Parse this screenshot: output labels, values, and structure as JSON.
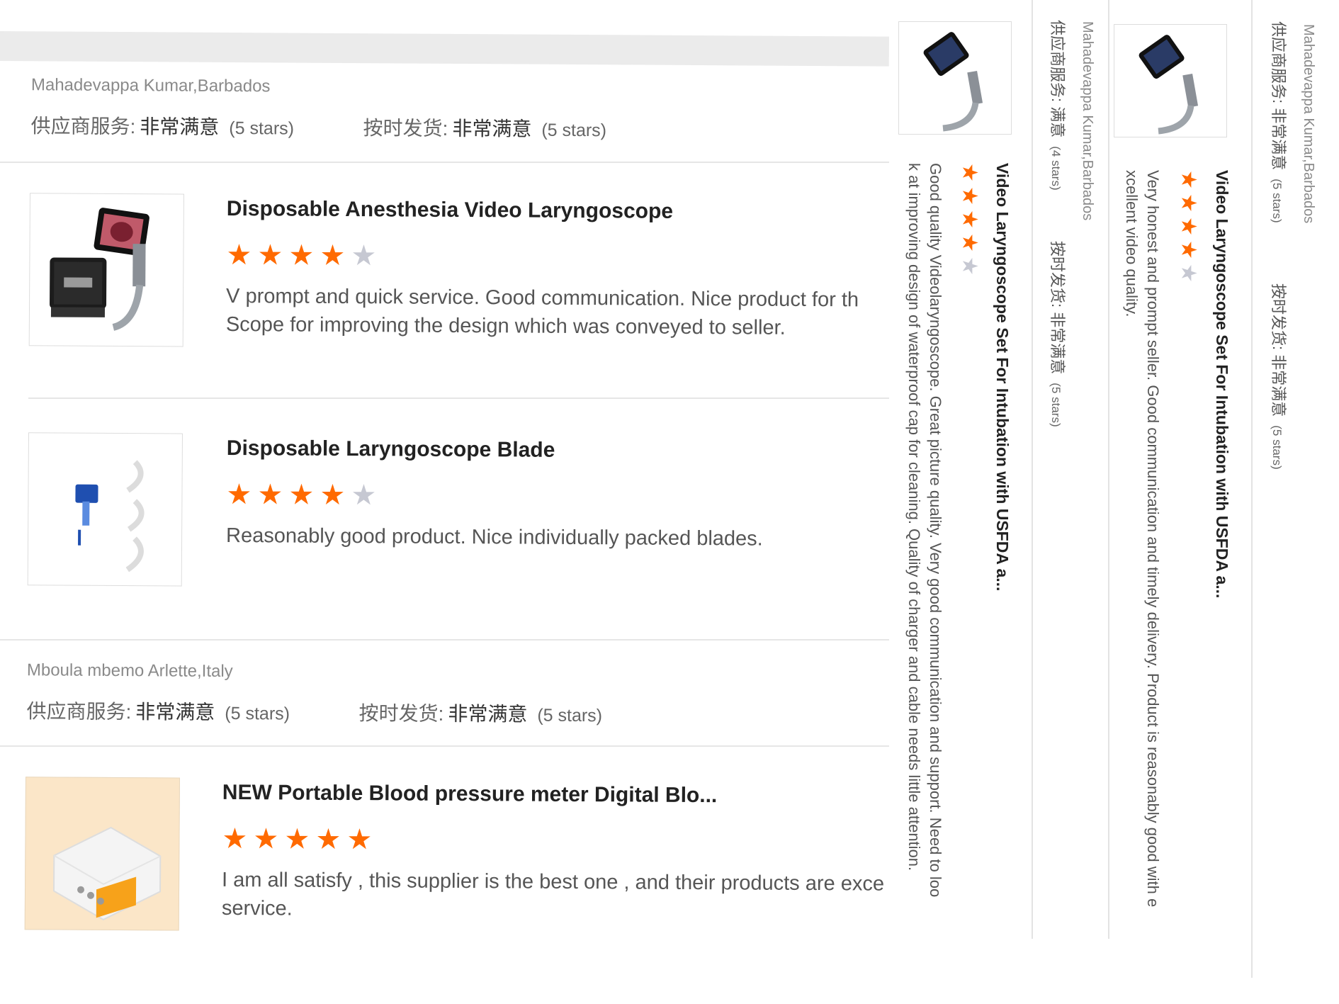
{
  "reviews": [
    {
      "reviewer": "Mahadevappa Kumar,Barbados",
      "supplier_label": "供应商服务:",
      "supplier_value": "非常满意",
      "supplier_stars": "(5 stars)",
      "delivery_label": "按时发货:",
      "delivery_value": "非常满意",
      "delivery_stars": "(5 stars)",
      "products": [
        {
          "title": "Disposable Anesthesia Video Laryngoscope",
          "rating": 4,
          "text_line1": "V prompt and quick service. Good communication. Nice product for th",
          "text_line2": "Scope for improving the design which was conveyed to seller.",
          "thumb_icon": "laryngoscope-case-icon"
        },
        {
          "title": "Disposable Laryngoscope Blade",
          "rating": 4,
          "text_line1": "Reasonably good product. Nice individually packed blades.",
          "thumb_icon": "laryngoscope-blade-icon"
        }
      ]
    },
    {
      "reviewer": "Mboula mbemo Arlette,Italy",
      "supplier_label": "供应商服务:",
      "supplier_value": "非常满意",
      "supplier_stars": "(5 stars)",
      "delivery_label": "按时发货:",
      "delivery_value": "非常满意",
      "delivery_stars": "(5 stars)",
      "products": [
        {
          "title": "NEW Portable Blood pressure meter Digital Blo...",
          "rating": 5,
          "text_line1": "I am all satisfy , this supplier is the best one , and their products are exce",
          "text_line2": "service.",
          "thumb_icon": "blood-pressure-monitor-icon"
        }
      ]
    }
  ],
  "rotated": {
    "col1": {
      "title": "Video Laryngoscope Set For Intubation with USFDA a...",
      "rating": 4,
      "text_line1": "Good quality Videolaryngoscope. Great picture quality. Very good communication and support. Need to loo",
      "text_line2": "k at improving design of waterproof cap for cleaning. Quality of charger and cable needs little attention."
    },
    "col2": {
      "reviewer": "Mahadevappa Kumar,Barbados",
      "supplier_label": "供应商服务:",
      "supplier_value": "满意",
      "supplier_stars": "(4 stars)",
      "delivery_label": "按时发货:",
      "delivery_value": "非常满意",
      "delivery_stars": "(5 stars)"
    },
    "col3": {
      "title": "Video Laryngoscope Set For Intubation with USFDA a...",
      "rating": 4,
      "text_line1": "Very honest and prompt seller. Good communication and timely delivery. Product is reasonably good with e",
      "text_line2": "xcellent video quality."
    },
    "col4": {
      "reviewer": "Mahadevappa Kumar,Barbados",
      "supplier_label": "供应商服务:",
      "supplier_value": "非常满意",
      "supplier_stars": "(5 stars)",
      "delivery_label": "按时发货:",
      "delivery_value": "非常满意",
      "delivery_stars": "(5 stars)"
    }
  },
  "colors": {
    "star_on": "#ff6a00",
    "star_off": "#c6c8d2",
    "link_blue": "#3a7fd5"
  }
}
